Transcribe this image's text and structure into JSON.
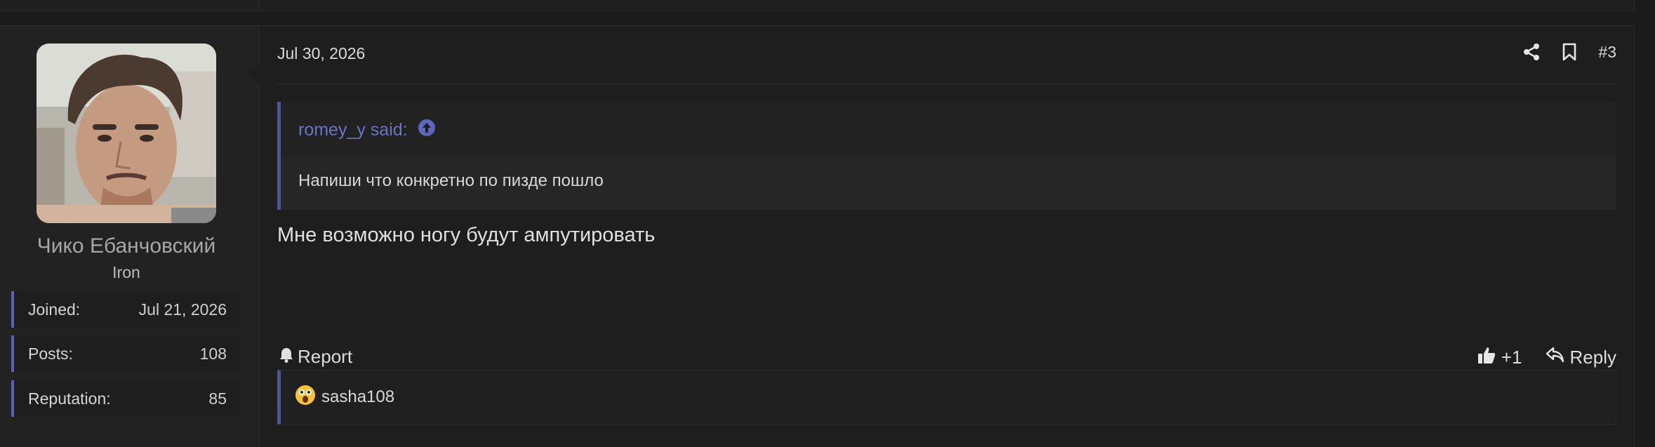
{
  "post": {
    "date": "Jul 30, 2026",
    "number": "#3",
    "author": {
      "name": "Чико Ебанчовский",
      "title": "Iron",
      "stats": [
        {
          "label": "Joined:",
          "value": "Jul 21, 2026"
        },
        {
          "label": "Posts:",
          "value": "108"
        },
        {
          "label": "Reputation:",
          "value": "85"
        }
      ]
    },
    "quote": {
      "author_said": "romey_y said:",
      "text": "Напиши что конкретно по пизде пошло"
    },
    "message": "Мне возможно ногу будут ампутировать",
    "actions": {
      "report": "Report",
      "like": "+1",
      "reply": "Reply"
    },
    "reactions": {
      "user": "sasha108"
    }
  },
  "colors": {
    "accent": "#5865b5",
    "quote_link": "#6a74c7",
    "background": "#1b1b1b"
  },
  "icons": [
    "share-icon",
    "bookmark-icon",
    "arrow-up-circle-icon",
    "bell-icon",
    "thumbs-up-icon",
    "reply-icon",
    "astonished-emoji-icon"
  ]
}
